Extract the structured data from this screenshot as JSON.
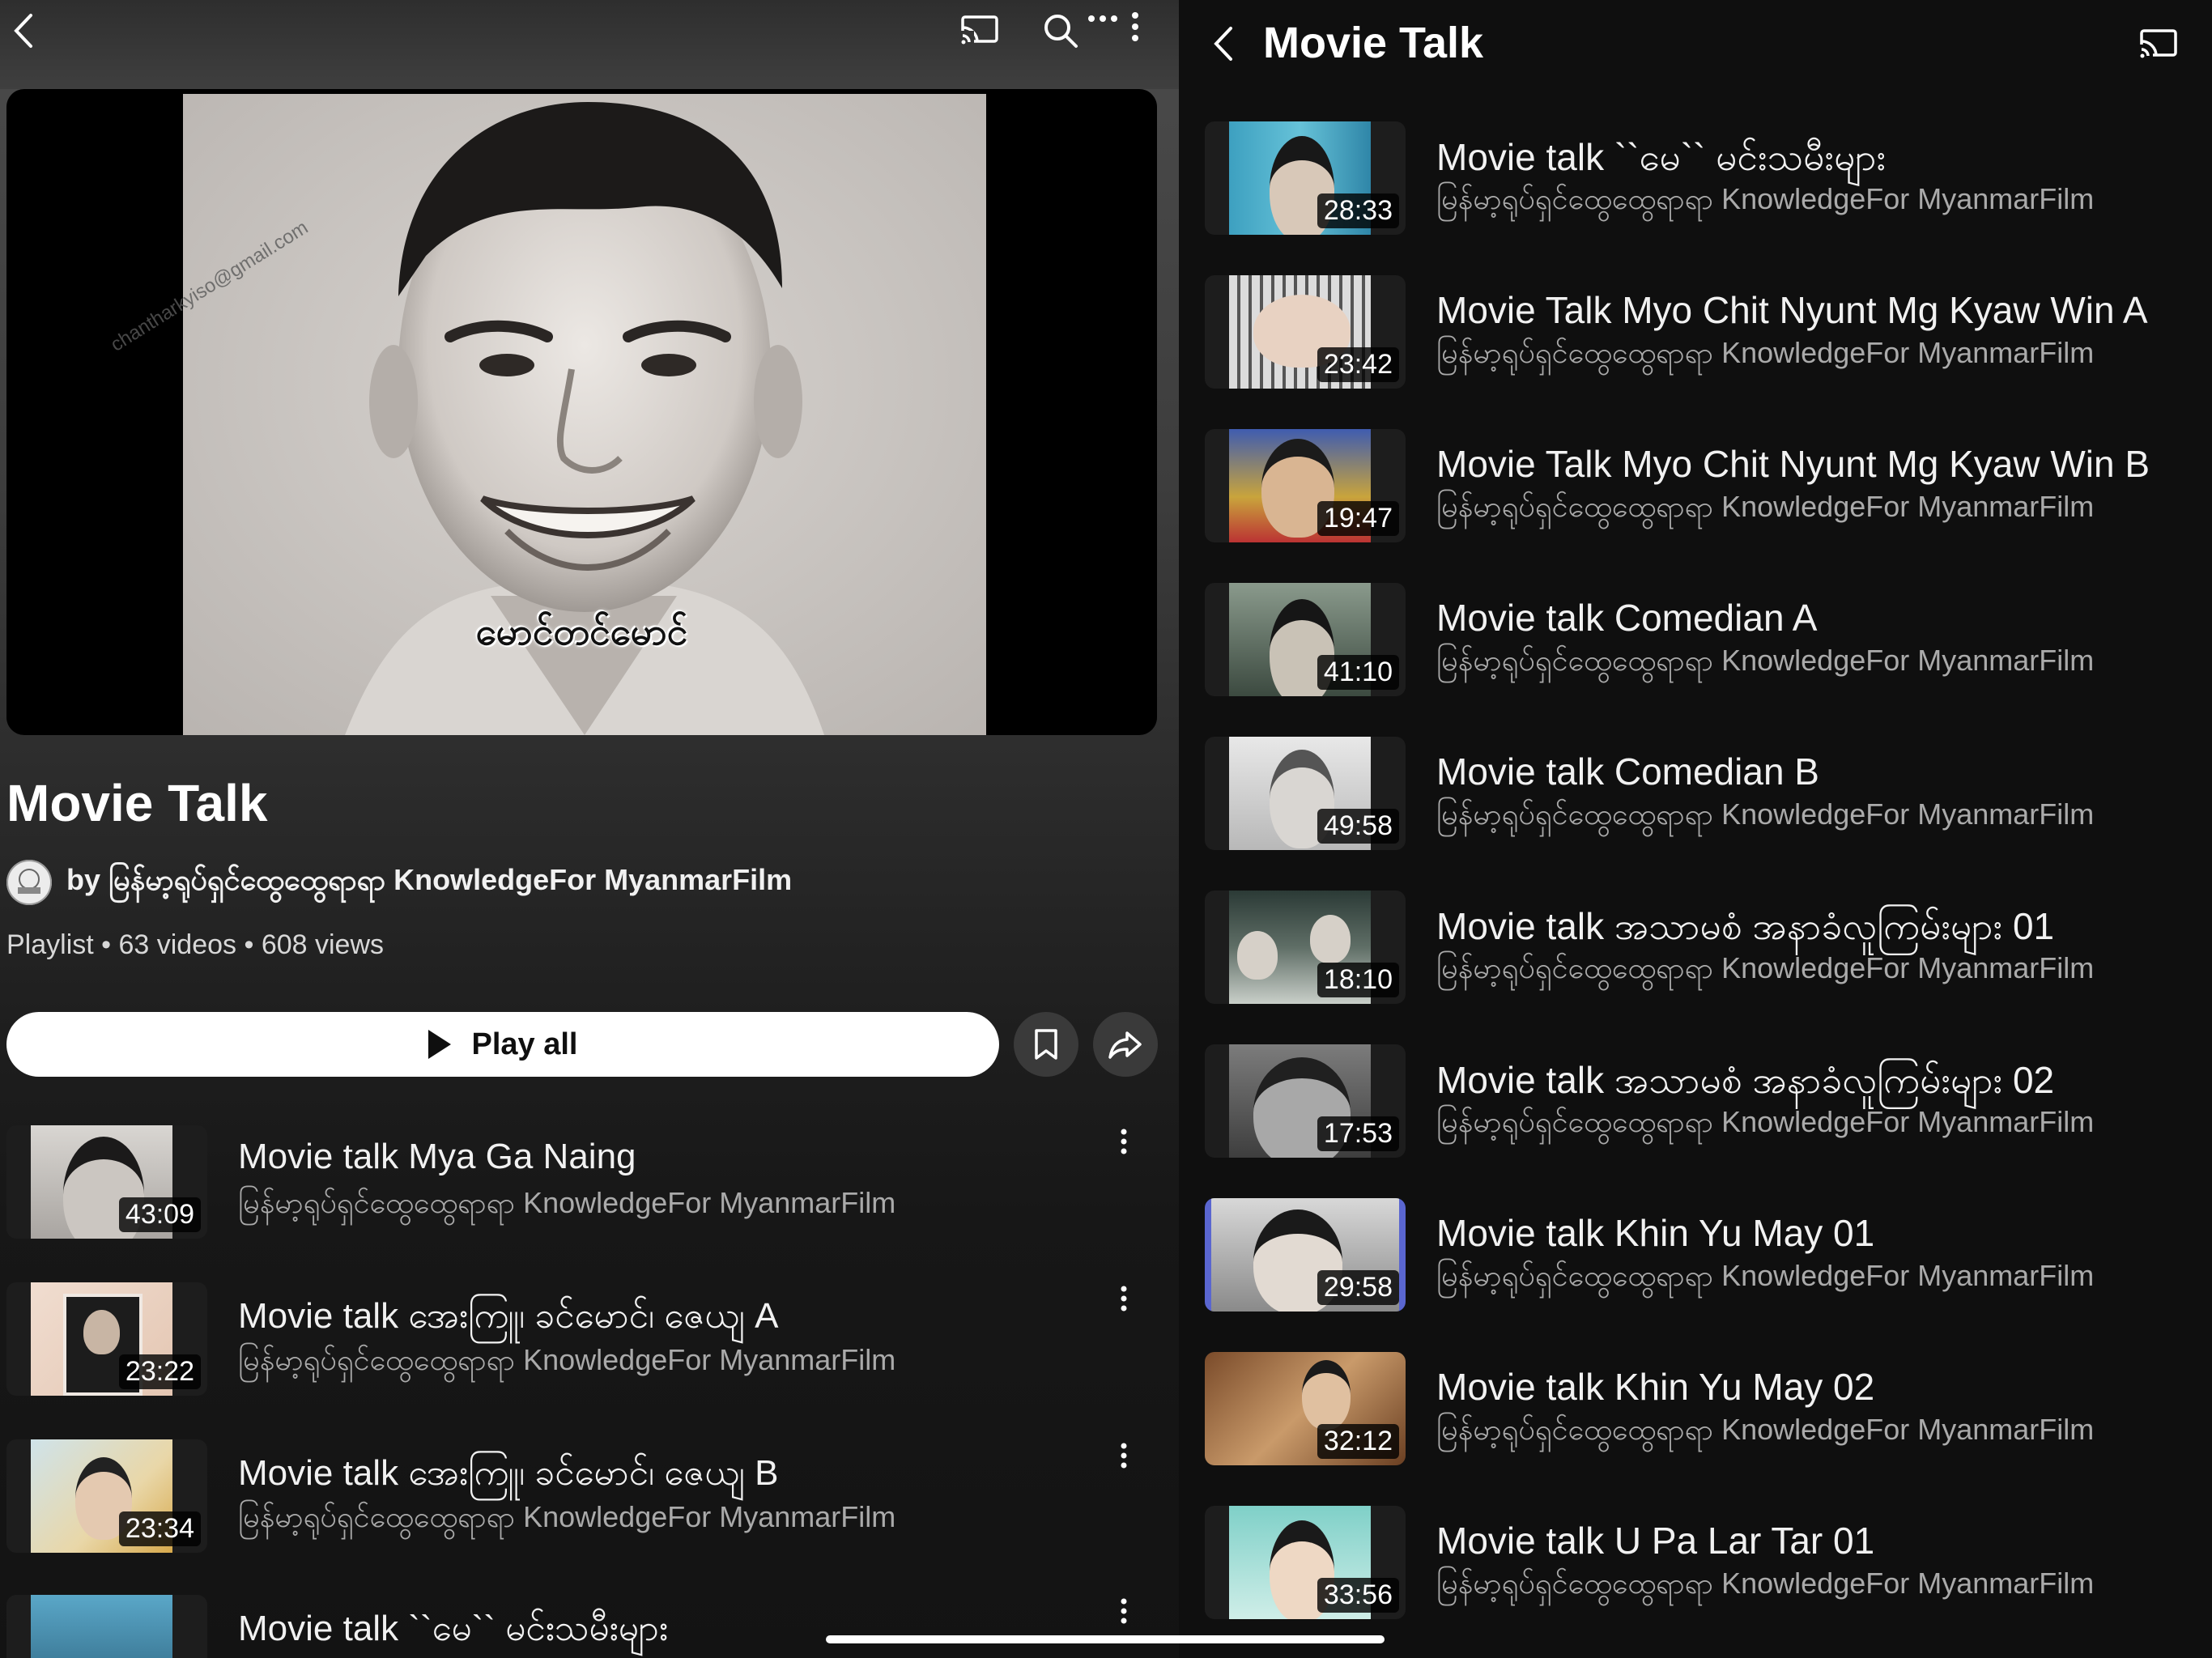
{
  "playlist": {
    "title": "Movie Talk",
    "owner": "by မြန်မာ့ရုပ်ရှင်ထွေထွေရာရာ KnowledgeFor MyanmarFilm",
    "meta": "Playlist • 63 videos • 608 views",
    "play_all_label": "Play all",
    "hero_caption": "မောင်တင်မောင်",
    "hero_watermark": "chantharkyiso@gmail.com"
  },
  "left_videos": [
    {
      "title": "Movie talk Mya Ga Naing",
      "channel": "မြန်မာ့ရုပ်ရှင်ထွေထွေရာရာ KnowledgeFor MyanmarFilm",
      "duration": "43:09"
    },
    {
      "title": "Movie talk အေးကြူ၊ ခင်မောင်၊ ဇေယျ A",
      "channel": "မြန်မာ့ရုပ်ရှင်ထွေထွေရာရာ KnowledgeFor MyanmarFilm",
      "duration": "23:22"
    },
    {
      "title": "Movie talk အေးကြူ၊ ခင်မောင်၊ ဇေယျ B",
      "channel": "မြန်မာ့ရုပ်ရှင်ထွေထွေရာရာ KnowledgeFor MyanmarFilm",
      "duration": "23:34"
    },
    {
      "title": "Movie talk ``မေ`` မင်းသမီးများ",
      "channel": "",
      "duration": ""
    }
  ],
  "right_panel": {
    "title": "Movie Talk",
    "videos": [
      {
        "title": "Movie talk ``မေ`` မင်းသမီးများ",
        "channel": "မြန်မာ့ရုပ်ရှင်ထွေထွေရာရာ KnowledgeFor MyanmarFilm",
        "duration": "28:33"
      },
      {
        "title": "Movie Talk Myo Chit Nyunt Mg Kyaw Win A",
        "channel": "မြန်မာ့ရုပ်ရှင်ထွေထွေရာရာ KnowledgeFor MyanmarFilm",
        "duration": "23:42"
      },
      {
        "title": "Movie Talk Myo Chit Nyunt Mg Kyaw Win B",
        "channel": "မြန်မာ့ရုပ်ရှင်ထွေထွေရာရာ KnowledgeFor MyanmarFilm",
        "duration": "19:47"
      },
      {
        "title": "Movie talk Comedian A",
        "channel": "မြန်မာ့ရုပ်ရှင်ထွေထွေရာရာ KnowledgeFor MyanmarFilm",
        "duration": "41:10"
      },
      {
        "title": "Movie talk Comedian B",
        "channel": "မြန်မာ့ရုပ်ရှင်ထွေထွေရာရာ KnowledgeFor MyanmarFilm",
        "duration": "49:58"
      },
      {
        "title": "Movie talk အသာမစံ အနာခံလူကြမ်းများ 01",
        "channel": "မြန်မာ့ရုပ်ရှင်ထွေထွေရာရာ KnowledgeFor MyanmarFilm",
        "duration": "18:10"
      },
      {
        "title": "Movie talk အသာမစံ အနာခံလူကြမ်းများ 02",
        "channel": "မြန်မာ့ရုပ်ရှင်ထွေထွေရာရာ KnowledgeFor MyanmarFilm",
        "duration": "17:53"
      },
      {
        "title": "Movie talk Khin Yu May 01",
        "channel": "မြန်မာ့ရုပ်ရှင်ထွေထွေရာရာ KnowledgeFor MyanmarFilm",
        "duration": "29:58"
      },
      {
        "title": "Movie talk Khin Yu May 02",
        "channel": "မြန်မာ့ရုပ်ရှင်ထွေထွေရာရာ KnowledgeFor MyanmarFilm",
        "duration": "32:12"
      },
      {
        "title": "Movie talk U Pa Lar Tar 01",
        "channel": "မြန်မာ့ရုပ်ရှင်ထွေထွေရာရာ KnowledgeFor MyanmarFilm",
        "duration": "33:56"
      }
    ]
  },
  "colors": {
    "background": "#0f0f0f",
    "secondary_text": "#aaaaaa",
    "play_button": "#ffffff"
  }
}
